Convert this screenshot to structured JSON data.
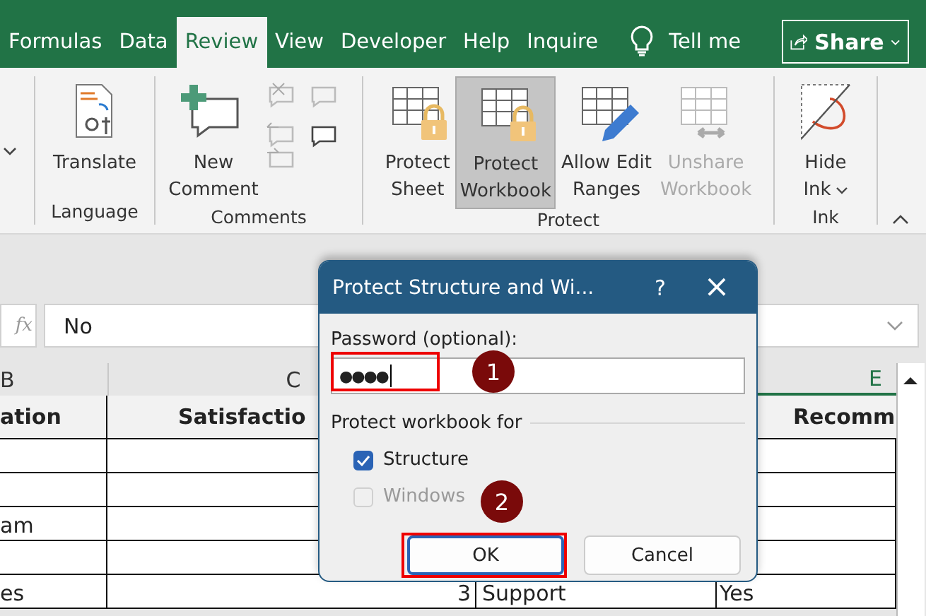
{
  "ribbon_tabs": [
    {
      "label": "Formulas",
      "selected": false
    },
    {
      "label": "Data",
      "selected": false
    },
    {
      "label": "Review",
      "selected": true
    },
    {
      "label": "View",
      "selected": false
    },
    {
      "label": "Developer",
      "selected": false
    },
    {
      "label": "Help",
      "selected": false
    },
    {
      "label": "Inquire",
      "selected": false
    }
  ],
  "tell_me": "Tell me",
  "share_button": "Share",
  "groups": [
    {
      "label": "Language",
      "commands": [
        {
          "lines": [
            "Translate"
          ],
          "selected": false,
          "disabled": false,
          "dropdown": false
        }
      ]
    },
    {
      "label": "Comments",
      "commands": [
        {
          "lines": [
            "New",
            "Comment"
          ],
          "selected": false,
          "disabled": false,
          "dropdown": false
        }
      ]
    },
    {
      "label": "Protect",
      "commands": [
        {
          "lines": [
            "Protect",
            "Sheet"
          ],
          "selected": false,
          "disabled": false,
          "dropdown": false
        },
        {
          "lines": [
            "Protect",
            "Workbook"
          ],
          "selected": true,
          "disabled": false,
          "dropdown": false
        },
        {
          "lines": [
            "Allow Edit",
            "Ranges"
          ],
          "selected": false,
          "disabled": false,
          "dropdown": false
        },
        {
          "lines": [
            "Unshare",
            "Workbook"
          ],
          "selected": false,
          "disabled": true,
          "dropdown": false
        }
      ]
    },
    {
      "label": "Ink",
      "commands": [
        {
          "lines": [
            "Hide",
            "Ink"
          ],
          "selected": false,
          "disabled": false,
          "dropdown": true
        }
      ]
    }
  ],
  "formula_bar": {
    "function_label": "fx",
    "value": "No"
  },
  "columns": [
    "B",
    "C",
    null,
    "E"
  ],
  "header_row": [
    "ation",
    "Satisfactio",
    "Recomm"
  ],
  "rows": [
    [
      null,
      null,
      null,
      null
    ],
    [
      null,
      null,
      null,
      null
    ],
    [
      "am",
      null,
      null,
      null
    ],
    [
      null,
      null,
      null,
      null
    ],
    [
      "es",
      "3",
      "Support",
      "Yes"
    ]
  ],
  "dialog": {
    "title": "Protect Structure and Wi...",
    "help": "?",
    "close": "×",
    "password_label": "Password (optional):",
    "password_value": "●●●●",
    "section_label": "Protect workbook for",
    "options": [
      {
        "label": "Structure",
        "checked": true,
        "disabled": false
      },
      {
        "label": "Windows",
        "checked": false,
        "disabled": true
      }
    ],
    "buttons": [
      {
        "label": "OK",
        "focused": true
      },
      {
        "label": "Cancel",
        "focused": false
      }
    ]
  },
  "callouts": [
    "1",
    "2"
  ]
}
